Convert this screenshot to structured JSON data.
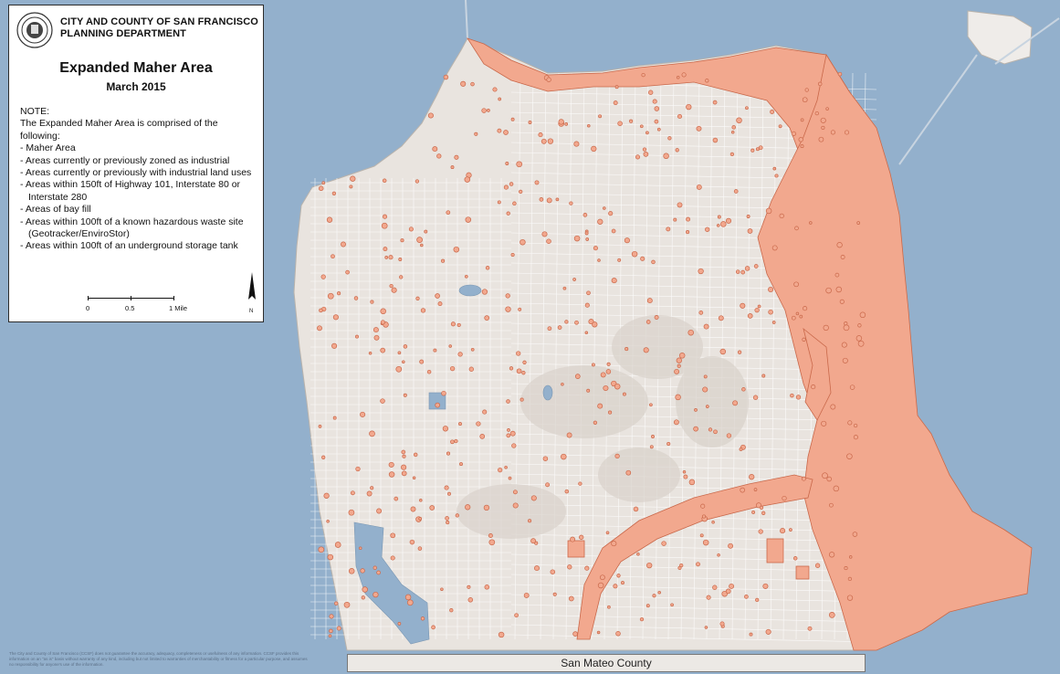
{
  "header": {
    "agency_line1": "CITY AND COUNTY OF SAN FRANCISCO",
    "agency_line2": "PLANNING DEPARTMENT"
  },
  "map": {
    "title": "Expanded Maher Area",
    "date": "March 2015"
  },
  "note": {
    "heading": "NOTE:",
    "intro": "The Expanded Maher Area is comprised of the following:",
    "items": [
      "Maher Area",
      "Areas currently or previously zoned as industrial",
      "Areas currently or previously with industrial land uses",
      "Areas within 150ft of Highway 101, Interstate 80 or Interstate 280",
      "Areas of bay fill",
      "Areas within 100ft of a known hazardous waste site (Geotracker/EnviroStor)",
      "Areas within 100ft of an underground storage tank"
    ]
  },
  "scale_bar": {
    "labels": [
      "0",
      "0.5",
      "1 Mile"
    ]
  },
  "north_arrow": {
    "label": "N"
  },
  "county_label": "San Mateo County",
  "disclaimer": "The City and County of San Francisco (CCSF) does not guarantee the accuracy, adequacy, completeness or usefulness of any information. CCSF provides this information on an \"as is\" basis without warranty of any kind, including but not limited to warranties of merchantability or fitness for a particular purpose, and assumes no responsibility for anyone's use of the information.",
  "colors": {
    "water": "#93b0cc",
    "land": "#e9e4df",
    "maher_area": "#f2a88e",
    "maher_outline": "#c9684a",
    "streets": "#ffffff"
  }
}
